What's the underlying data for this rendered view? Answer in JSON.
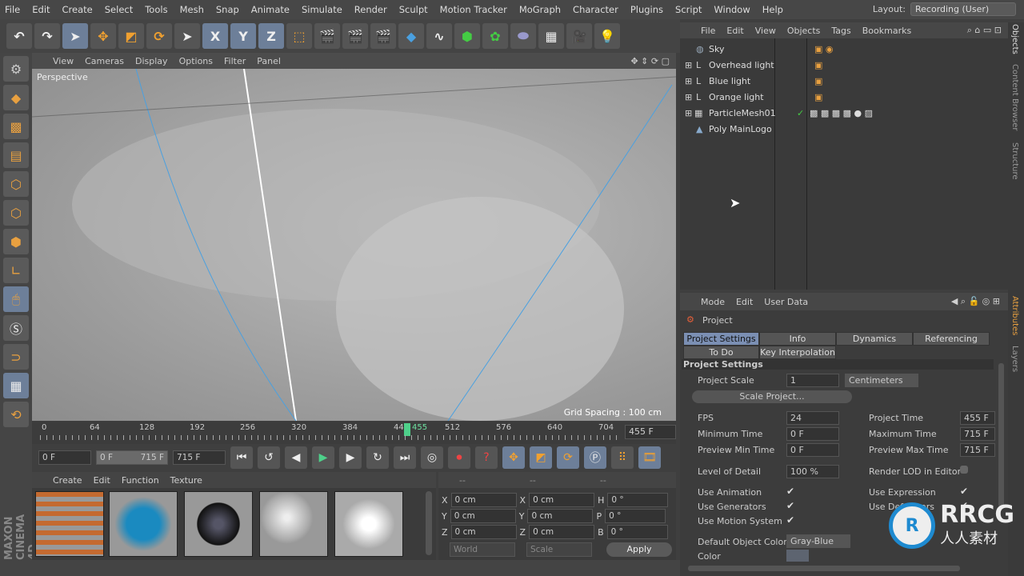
{
  "menubar": {
    "items": [
      "File",
      "Edit",
      "Create",
      "Select",
      "Tools",
      "Mesh",
      "Snap",
      "Animate",
      "Simulate",
      "Render",
      "Sculpt",
      "Motion Tracker",
      "MoGraph",
      "Character",
      "Plugins",
      "Script",
      "Window",
      "Help"
    ],
    "layout_label": "Layout:",
    "layout_value": "Recording (User)"
  },
  "toolbar": {
    "axes": [
      "X",
      "Y",
      "Z"
    ]
  },
  "viewport": {
    "menu": [
      "View",
      "Cameras",
      "Display",
      "Options",
      "Filter",
      "Panel"
    ],
    "camera": "Perspective",
    "grid_spacing": "Grid Spacing : 100 cm"
  },
  "timeline": {
    "ticks": [
      "0",
      "64",
      "128",
      "192",
      "256",
      "320",
      "384",
      "44",
      "455",
      "512",
      "576",
      "640",
      "704"
    ],
    "current": "455 F",
    "current_frame": 455,
    "max_frame": 715
  },
  "transport": {
    "start": "0 F",
    "range_start": "0 F",
    "range_end": "715 F",
    "end": "715 F"
  },
  "materials": {
    "menu": [
      "Create",
      "Edit",
      "Function",
      "Texture"
    ]
  },
  "coords": {
    "headers": [
      "--",
      "--",
      "--"
    ],
    "rows": [
      [
        "X",
        "0 cm",
        "X",
        "0 cm",
        "H",
        "0 °"
      ],
      [
        "Y",
        "0 cm",
        "Y",
        "0 cm",
        "P",
        "0 °"
      ],
      [
        "Z",
        "0 cm",
        "Z",
        "0 cm",
        "B",
        "0 °"
      ]
    ],
    "mode": "World",
    "size_mode": "Scale",
    "apply": "Apply"
  },
  "branding": {
    "logo": "MAXON CINEMA 4D"
  },
  "objects": {
    "menu": [
      "File",
      "Edit",
      "View",
      "Objects",
      "Tags",
      "Bookmarks"
    ],
    "items": [
      {
        "name": "Sky",
        "icon": "sky-icon"
      },
      {
        "name": "Overhead light",
        "icon": "light-icon"
      },
      {
        "name": "Blue light",
        "icon": "light-icon"
      },
      {
        "name": "Orange light",
        "icon": "light-icon"
      },
      {
        "name": "ParticleMesh01",
        "icon": "mesh-icon"
      },
      {
        "name": "Poly MainLogo",
        "icon": "polygon-icon"
      }
    ]
  },
  "attributes": {
    "menu": [
      "Mode",
      "Edit",
      "User Data"
    ],
    "object": "Project",
    "tabs": [
      "Project Settings",
      "Info",
      "Dynamics",
      "Referencing",
      "To Do",
      "Key Interpolation"
    ],
    "section": "Project Settings",
    "project_scale_label": "Project Scale",
    "project_scale": "1",
    "units": "Centimeters",
    "scale_button": "Scale Project...",
    "fps_label": "FPS",
    "fps": "24",
    "min_time_label": "Minimum Time",
    "min_time": "0 F",
    "prev_min_label": "Preview Min Time",
    "prev_min": "0 F",
    "proj_time_label": "Project Time",
    "proj_time": "455 F",
    "max_time_label": "Maximum Time",
    "max_time": "715 F",
    "prev_max_label": "Preview Max Time",
    "prev_max": "715 F",
    "lod_label": "Level of Detail",
    "lod": "100 %",
    "render_lod_label": "Render LOD in Editor",
    "use_animation": "Use Animation",
    "use_generators": "Use Generators",
    "use_motion": "Use Motion System",
    "use_expression": "Use Expression",
    "use_deformers": "Use Deformers",
    "default_color_label": "Default Object Color",
    "default_color": "Gray-Blue",
    "color_label": "Color"
  },
  "sidetabs": [
    "Objects",
    "Content Browser",
    "Structure",
    "Attributes",
    "Layers"
  ],
  "watermark": {
    "text": "RRCG",
    "sub": "人人素材"
  }
}
